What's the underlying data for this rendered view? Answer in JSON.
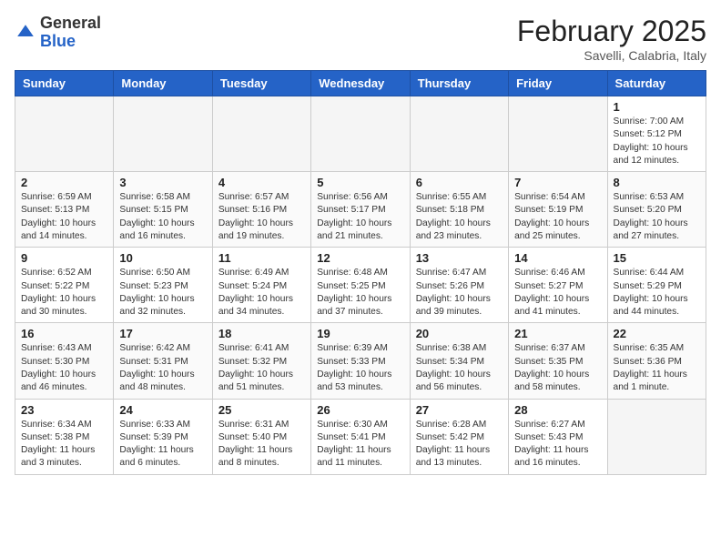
{
  "header": {
    "logo_general": "General",
    "logo_blue": "Blue",
    "month_title": "February 2025",
    "location": "Savelli, Calabria, Italy"
  },
  "days_of_week": [
    "Sunday",
    "Monday",
    "Tuesday",
    "Wednesday",
    "Thursday",
    "Friday",
    "Saturday"
  ],
  "weeks": [
    [
      {
        "day": "",
        "info": ""
      },
      {
        "day": "",
        "info": ""
      },
      {
        "day": "",
        "info": ""
      },
      {
        "day": "",
        "info": ""
      },
      {
        "day": "",
        "info": ""
      },
      {
        "day": "",
        "info": ""
      },
      {
        "day": "1",
        "info": "Sunrise: 7:00 AM\nSunset: 5:12 PM\nDaylight: 10 hours and 12 minutes."
      }
    ],
    [
      {
        "day": "2",
        "info": "Sunrise: 6:59 AM\nSunset: 5:13 PM\nDaylight: 10 hours and 14 minutes."
      },
      {
        "day": "3",
        "info": "Sunrise: 6:58 AM\nSunset: 5:15 PM\nDaylight: 10 hours and 16 minutes."
      },
      {
        "day": "4",
        "info": "Sunrise: 6:57 AM\nSunset: 5:16 PM\nDaylight: 10 hours and 19 minutes."
      },
      {
        "day": "5",
        "info": "Sunrise: 6:56 AM\nSunset: 5:17 PM\nDaylight: 10 hours and 21 minutes."
      },
      {
        "day": "6",
        "info": "Sunrise: 6:55 AM\nSunset: 5:18 PM\nDaylight: 10 hours and 23 minutes."
      },
      {
        "day": "7",
        "info": "Sunrise: 6:54 AM\nSunset: 5:19 PM\nDaylight: 10 hours and 25 minutes."
      },
      {
        "day": "8",
        "info": "Sunrise: 6:53 AM\nSunset: 5:20 PM\nDaylight: 10 hours and 27 minutes."
      }
    ],
    [
      {
        "day": "9",
        "info": "Sunrise: 6:52 AM\nSunset: 5:22 PM\nDaylight: 10 hours and 30 minutes."
      },
      {
        "day": "10",
        "info": "Sunrise: 6:50 AM\nSunset: 5:23 PM\nDaylight: 10 hours and 32 minutes."
      },
      {
        "day": "11",
        "info": "Sunrise: 6:49 AM\nSunset: 5:24 PM\nDaylight: 10 hours and 34 minutes."
      },
      {
        "day": "12",
        "info": "Sunrise: 6:48 AM\nSunset: 5:25 PM\nDaylight: 10 hours and 37 minutes."
      },
      {
        "day": "13",
        "info": "Sunrise: 6:47 AM\nSunset: 5:26 PM\nDaylight: 10 hours and 39 minutes."
      },
      {
        "day": "14",
        "info": "Sunrise: 6:46 AM\nSunset: 5:27 PM\nDaylight: 10 hours and 41 minutes."
      },
      {
        "day": "15",
        "info": "Sunrise: 6:44 AM\nSunset: 5:29 PM\nDaylight: 10 hours and 44 minutes."
      }
    ],
    [
      {
        "day": "16",
        "info": "Sunrise: 6:43 AM\nSunset: 5:30 PM\nDaylight: 10 hours and 46 minutes."
      },
      {
        "day": "17",
        "info": "Sunrise: 6:42 AM\nSunset: 5:31 PM\nDaylight: 10 hours and 48 minutes."
      },
      {
        "day": "18",
        "info": "Sunrise: 6:41 AM\nSunset: 5:32 PM\nDaylight: 10 hours and 51 minutes."
      },
      {
        "day": "19",
        "info": "Sunrise: 6:39 AM\nSunset: 5:33 PM\nDaylight: 10 hours and 53 minutes."
      },
      {
        "day": "20",
        "info": "Sunrise: 6:38 AM\nSunset: 5:34 PM\nDaylight: 10 hours and 56 minutes."
      },
      {
        "day": "21",
        "info": "Sunrise: 6:37 AM\nSunset: 5:35 PM\nDaylight: 10 hours and 58 minutes."
      },
      {
        "day": "22",
        "info": "Sunrise: 6:35 AM\nSunset: 5:36 PM\nDaylight: 11 hours and 1 minute."
      }
    ],
    [
      {
        "day": "23",
        "info": "Sunrise: 6:34 AM\nSunset: 5:38 PM\nDaylight: 11 hours and 3 minutes."
      },
      {
        "day": "24",
        "info": "Sunrise: 6:33 AM\nSunset: 5:39 PM\nDaylight: 11 hours and 6 minutes."
      },
      {
        "day": "25",
        "info": "Sunrise: 6:31 AM\nSunset: 5:40 PM\nDaylight: 11 hours and 8 minutes."
      },
      {
        "day": "26",
        "info": "Sunrise: 6:30 AM\nSunset: 5:41 PM\nDaylight: 11 hours and 11 minutes."
      },
      {
        "day": "27",
        "info": "Sunrise: 6:28 AM\nSunset: 5:42 PM\nDaylight: 11 hours and 13 minutes."
      },
      {
        "day": "28",
        "info": "Sunrise: 6:27 AM\nSunset: 5:43 PM\nDaylight: 11 hours and 16 minutes."
      },
      {
        "day": "",
        "info": ""
      }
    ]
  ]
}
